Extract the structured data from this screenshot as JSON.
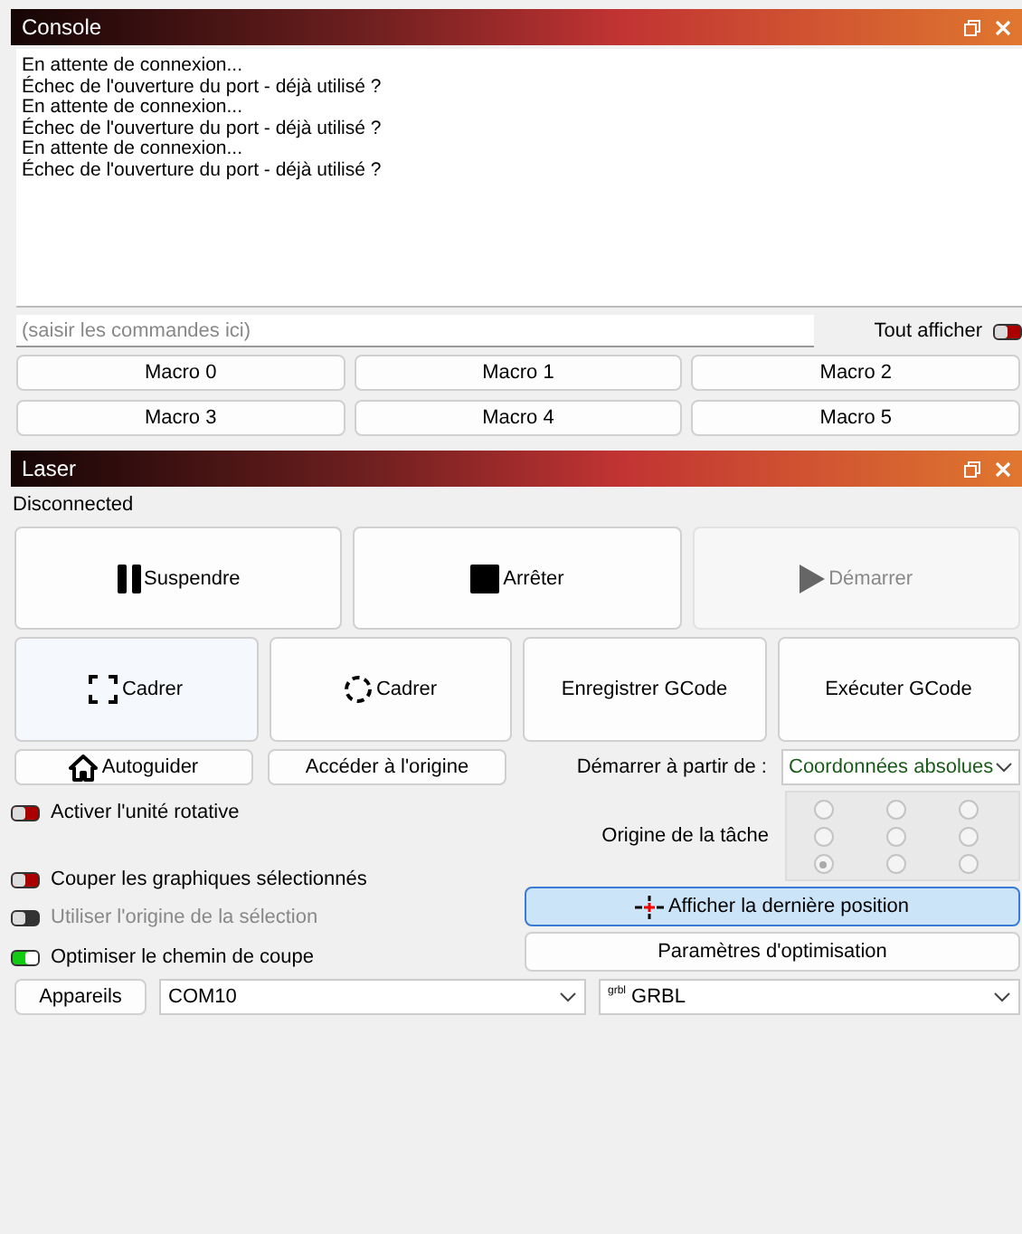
{
  "console": {
    "title": "Console",
    "log": [
      "En attente de connexion...",
      "Échec de l'ouverture du port - déjà utilisé ?",
      "En attente de connexion...",
      "Échec de l'ouverture du port - déjà utilisé ?",
      "En attente de connexion...",
      "Échec de l'ouverture du port - déjà utilisé ?"
    ],
    "command_input": {
      "placeholder": "(saisir les commandes ici)"
    },
    "show_all": {
      "label": "Tout afficher",
      "on": false
    },
    "macros": [
      "Macro 0",
      "Macro 1",
      "Macro 2",
      "Macro 3",
      "Macro 4",
      "Macro 5"
    ]
  },
  "laser": {
    "title": "Laser",
    "status": "Disconnected",
    "control_buttons": [
      {
        "label": "Suspendre",
        "kind": "pause",
        "disabled": false
      },
      {
        "label": "Arrêter",
        "kind": "stop",
        "disabled": false
      },
      {
        "label": "Démarrer",
        "kind": "play",
        "disabled": true
      }
    ],
    "frame_buttons": [
      {
        "label": "Cadrer",
        "kind": "rectframe"
      },
      {
        "label": "Cadrer",
        "kind": "circleframe"
      },
      {
        "label": "Enregistrer GCode",
        "kind": "text"
      },
      {
        "label": "Exécuter GCode",
        "kind": "text"
      }
    ],
    "home_buttons": [
      {
        "label": "Autoguider",
        "kind": "home"
      },
      {
        "label": "Accéder à l'origine",
        "kind": "text"
      }
    ],
    "start_from": {
      "label": "Démarrer à partir de :",
      "value": "Coordonnées absolues"
    },
    "options": [
      {
        "label": "Activer l'unité rotative",
        "on": false,
        "disabled": false
      },
      {
        "label": "Couper les graphiques sélectionnés",
        "on": false,
        "disabled": false
      },
      {
        "label": "Utiliser l'origine de la sélection",
        "on": false,
        "disabled": true
      },
      {
        "label": "Optimiser le chemin de coupe",
        "on": true,
        "disabled": false
      }
    ],
    "job_origin": {
      "label": "Origine de la tâche",
      "points": [
        {
          "selected": false
        },
        {
          "selected": false
        },
        {
          "selected": false
        },
        {
          "selected": false
        },
        {
          "selected": false
        },
        {
          "selected": false
        },
        {
          "selected": true
        },
        {
          "selected": false
        },
        {
          "selected": false
        }
      ]
    },
    "show_last_position": {
      "label": "Afficher la dernière position"
    },
    "optimization_settings": {
      "label": "Paramètres d'optimisation"
    },
    "devices_button": {
      "label": "Appareils"
    },
    "port": {
      "value": "COM10"
    },
    "controller": {
      "badge": "grbl",
      "value": "GRBL"
    }
  }
}
